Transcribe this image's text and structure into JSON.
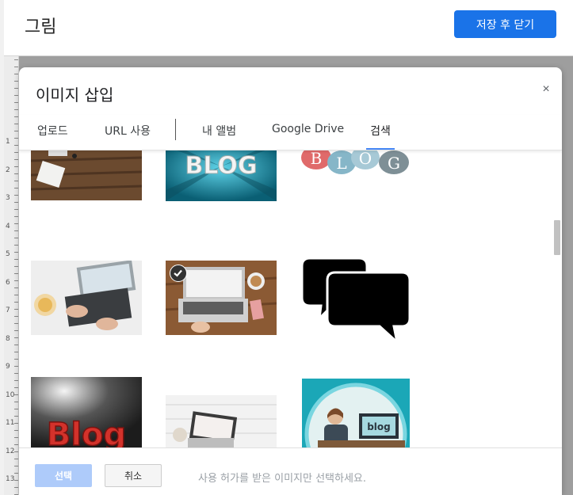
{
  "editor": {
    "title": "그림",
    "save_close_label": "저장 후 닫기"
  },
  "ruler": {
    "numbers": [
      "1",
      "2",
      "3",
      "4",
      "5",
      "6",
      "7",
      "8",
      "9",
      "10",
      "11",
      "12",
      "13"
    ]
  },
  "dialog": {
    "title": "이미지 삽입",
    "close_icon": "×",
    "tabs": [
      {
        "label": "업로드",
        "active": false
      },
      {
        "label": "URL 사용",
        "active": false
      },
      {
        "label": "내 앨범",
        "active": false
      },
      {
        "label": "Google Drive",
        "active": false
      },
      {
        "label": "검색",
        "active": true
      }
    ],
    "results": [
      {
        "name": "desk-notebook-image"
      },
      {
        "name": "blog-3d-text-image"
      },
      {
        "name": "blog-speech-bubbles-image"
      },
      {
        "name": "laptop-typing-image"
      },
      {
        "name": "laptop-desk-phone-image",
        "selected": true
      },
      {
        "name": "speech-bubbles-icon-image"
      },
      {
        "name": "blog-red-letters-image"
      },
      {
        "name": "laptop-white-desk-image"
      },
      {
        "name": "blog-monitor-person-image"
      }
    ],
    "footer": {
      "select_label": "선택",
      "cancel_label": "취소",
      "hint": "사용 허가를 받은 이미지만 선택하세요."
    }
  },
  "colors": {
    "primary": "#1a73e8",
    "select_disabled": "#aecbfa",
    "tab_indicator": "#4285f4"
  }
}
